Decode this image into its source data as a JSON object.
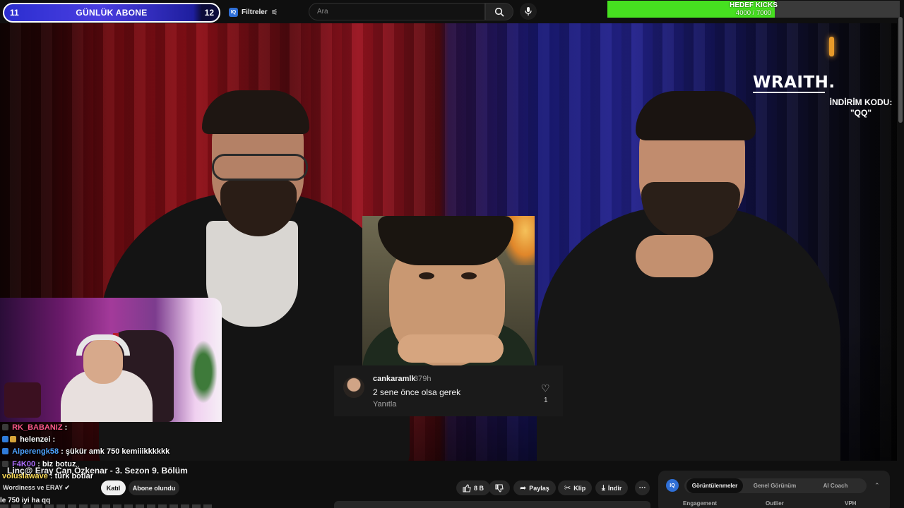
{
  "top_bar": {
    "sub_goal": {
      "left_count": "11",
      "title": "GÜNLÜK ABONE",
      "right_count": "12"
    },
    "filters_label": "Filtreler",
    "search_placeholder": "Ara",
    "kick_goal": {
      "title": "HEDEF KICKS",
      "progress_text": "4000 / 7000",
      "current": 4000,
      "target": 7000
    }
  },
  "video_overlay": {
    "brand": "WRAITH.",
    "promo_line1": "İNDİRİM KODU:",
    "promo_line2": "\"QQ\"",
    "comment": {
      "username": "cankaramlk",
      "time": "379h",
      "text": "2 sene önce olsa gerek",
      "reply_label": "Yanıtla",
      "likes": "1"
    }
  },
  "chat": [
    {
      "user": "RK_BABANIZ",
      "message": "",
      "color": "#ff5a8a"
    },
    {
      "user": "helenzei",
      "message": "",
      "color": "#ffffff"
    },
    {
      "user": "Alperengk58",
      "message": "şükür amk 750 kemiiikkkkkk",
      "color": "#4fa3ff"
    },
    {
      "user": "F4K00",
      "message": "biz botuz",
      "color": "#b070ff"
    },
    {
      "user": "voluslawave",
      "message": "türk botlar",
      "color": "#ffde59"
    }
  ],
  "video_info": {
    "title": "Linç@ Eray Can Özkenar - 3. Sezon 9. Bölüm",
    "channel": "Wordiness ve ERAY",
    "join_label": "Katıl",
    "subscribed_label": "Abone olundu",
    "likes": "8 B",
    "share_label": "Paylaş",
    "clip_label": "Klip",
    "download_label": "İndir",
    "bottom_left_text": "le 750 iyi ha qq"
  },
  "iq_panel": {
    "logo": "IQ",
    "tabs": [
      "Görüntülenmeler",
      "Genel Görünüm",
      "AI Coach"
    ],
    "active_tab": 0,
    "columns": [
      "Engagement",
      "Outlier",
      "VPH"
    ]
  },
  "icons": [
    "iq-filter-icon",
    "sliders-icon",
    "search-icon",
    "mic-icon",
    "heart-icon",
    "like-icon",
    "dislike-icon",
    "share-icon",
    "scissors-icon",
    "download-icon",
    "more-icon",
    "chevron-up-icon",
    "verified-icon"
  ]
}
